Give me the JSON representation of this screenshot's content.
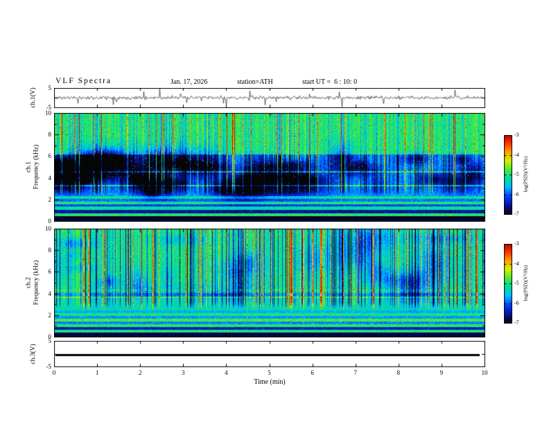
{
  "header": {
    "title": "VLF Spectra",
    "date": "Jan. 17, 2026",
    "station": "station=ATH",
    "start_ut": "start UT =  6 : 10: 0"
  },
  "xaxis": {
    "label": "Time (min)",
    "ticks": [
      0,
      1,
      2,
      3,
      4,
      5,
      6,
      7,
      8,
      9,
      10
    ],
    "range_min": [
      0,
      10
    ]
  },
  "colorbar": {
    "label": "log(PSD)(V²/Hz)",
    "ticks": [
      -3,
      -4,
      -5,
      -6,
      -7
    ],
    "range": [
      -7,
      -3
    ],
    "colormap": "jet-like",
    "stops": [
      [
        0,
        [
          5,
          5,
          5
        ]
      ],
      [
        0.09,
        [
          10,
          10,
          130
        ]
      ],
      [
        0.22,
        [
          0,
          60,
          255
        ]
      ],
      [
        0.35,
        [
          0,
          190,
          255
        ]
      ],
      [
        0.47,
        [
          0,
          225,
          150
        ]
      ],
      [
        0.58,
        [
          90,
          235,
          45
        ]
      ],
      [
        0.68,
        [
          215,
          240,
          0
        ]
      ],
      [
        0.78,
        [
          255,
          170,
          0
        ]
      ],
      [
        0.88,
        [
          255,
          70,
          0
        ]
      ],
      [
        1,
        [
          195,
          0,
          0
        ]
      ]
    ]
  },
  "panels": {
    "ch1_wave": {
      "ylabel": "ch.1(V)",
      "yticks": [
        5,
        -5
      ],
      "ylim": [
        -5,
        5
      ]
    },
    "ch1_spec": {
      "ylabel_line1": "ch.1",
      "ylabel_line2": "Frequency (kHz)",
      "yticks": [
        0,
        2,
        4,
        6,
        8,
        10
      ],
      "ylim": [
        0,
        10
      ]
    },
    "ch2_spec": {
      "ylabel_line1": "ch.2",
      "ylabel_line2": "Frequency (kHz)",
      "yticks": [
        0,
        2,
        4,
        6,
        8,
        10
      ],
      "ylim": [
        0,
        10
      ]
    },
    "ch3_wave": {
      "ylabel": "ch.3(V)",
      "yticks": [
        5,
        -5
      ],
      "ylim": [
        -5,
        5
      ]
    }
  },
  "chart_data": [
    {
      "id": "ch1_waveform",
      "type": "line",
      "x_range": [
        0,
        10
      ],
      "x_unit": "min",
      "y_range": [
        -5,
        5
      ],
      "y_unit": "V",
      "description": "Broadband noise centred on 0 V with frequent impulsive spikes reaching about ±5 V across the whole 10-minute record",
      "seed": 11,
      "spike_prob": 0.028,
      "noise_amp": 0.9
    },
    {
      "id": "ch1_spectrogram",
      "type": "heatmap",
      "x_range": [
        0,
        10
      ],
      "x_unit": "min",
      "y_range": [
        0,
        10
      ],
      "y_unit": "kHz",
      "value_range": [
        -7,
        -3
      ],
      "value_unit": "log(PSD)(V²/Hz)",
      "description": "Dense vertical burst striations 2.5-10 kHz; broad dark-blue low-power region 3-6 kHz; layered horizontal bands below 2.5 kHz; solid black band below ~0.45 kHz; orange/red speckle strongest above 6 kHz",
      "seed": 21,
      "bands": [
        [
          0,
          0.45,
          0.03
        ],
        [
          0.45,
          0.75,
          0.52
        ],
        [
          0.75,
          1.05,
          0.12
        ],
        [
          1.05,
          1.35,
          0.45
        ],
        [
          1.35,
          1.6,
          0.22
        ],
        [
          1.6,
          1.85,
          0.5
        ],
        [
          1.85,
          2.1,
          0.28
        ],
        [
          2.1,
          2.35,
          0.48
        ],
        [
          2.35,
          2.6,
          0.32
        ],
        [
          2.6,
          6.2,
          0.3
        ],
        [
          6.2,
          10.01,
          0.5
        ]
      ],
      "lines_khz": [
        3.3,
        4.6
      ],
      "burst_prob": 0.1,
      "dip_prob": 0.14,
      "dip_hi_factor": 0.45,
      "blob_count": 38,
      "blob_f": [
        2.8,
        6.2
      ],
      "blob_strength": -0.2,
      "speckle_prob": 0.02,
      "speckle_fmin": 4,
      "noise": 0.14,
      "env": [
        2.4,
        3.0
      ],
      "black_top": 0.45
    },
    {
      "id": "ch2_spectrogram",
      "type": "heatmap",
      "x_range": [
        0,
        10
      ],
      "x_unit": "min",
      "y_range": [
        0,
        10
      ],
      "y_unit": "kHz",
      "value_range": [
        -7,
        -3
      ],
      "value_unit": "log(PSD)(V²/Hz)",
      "description": "Mostly green mid-power field 4-10 kHz cut by narrow dark-blue vertical streaks and bright burst columns; fine horizontal green/yellow lines below 2.5 kHz; bright line near 3.7 kHz; black band below ~0.4 kHz",
      "seed": 33,
      "bands": [
        [
          0,
          0.4,
          0.05
        ],
        [
          0.4,
          0.7,
          0.5
        ],
        [
          0.7,
          0.95,
          0.15
        ],
        [
          0.95,
          1.2,
          0.52
        ],
        [
          1.2,
          1.45,
          0.3
        ],
        [
          1.45,
          1.7,
          0.55
        ],
        [
          1.7,
          1.95,
          0.32
        ],
        [
          1.95,
          2.2,
          0.5
        ],
        [
          2.2,
          2.5,
          0.35
        ],
        [
          2.5,
          3.6,
          0.45
        ],
        [
          3.6,
          3.78,
          0.6
        ],
        [
          3.78,
          4.1,
          0.35
        ],
        [
          4.1,
          10.01,
          0.48
        ]
      ],
      "lines_khz": [
        1.5,
        4.35
      ],
      "burst_prob": 0.09,
      "dip_prob": 0.18,
      "dip_hi_factor": 1,
      "blob_count": 26,
      "blob_f": [
        4,
        9.5
      ],
      "blob_strength": -0.13,
      "speckle_prob": 0.018,
      "speckle_fmin": 4,
      "noise": 0.13,
      "env": [
        2.5,
        3.2
      ],
      "black_top": 0.4
    },
    {
      "id": "ch3_waveform",
      "type": "line",
      "x_range": [
        0,
        10
      ],
      "x_unit": "min",
      "y_range": [
        -5,
        5
      ],
      "y_unit": "V",
      "description": "Flat thick line at 0 V - channel 3 carries no signal",
      "value_v": 0
    }
  ]
}
